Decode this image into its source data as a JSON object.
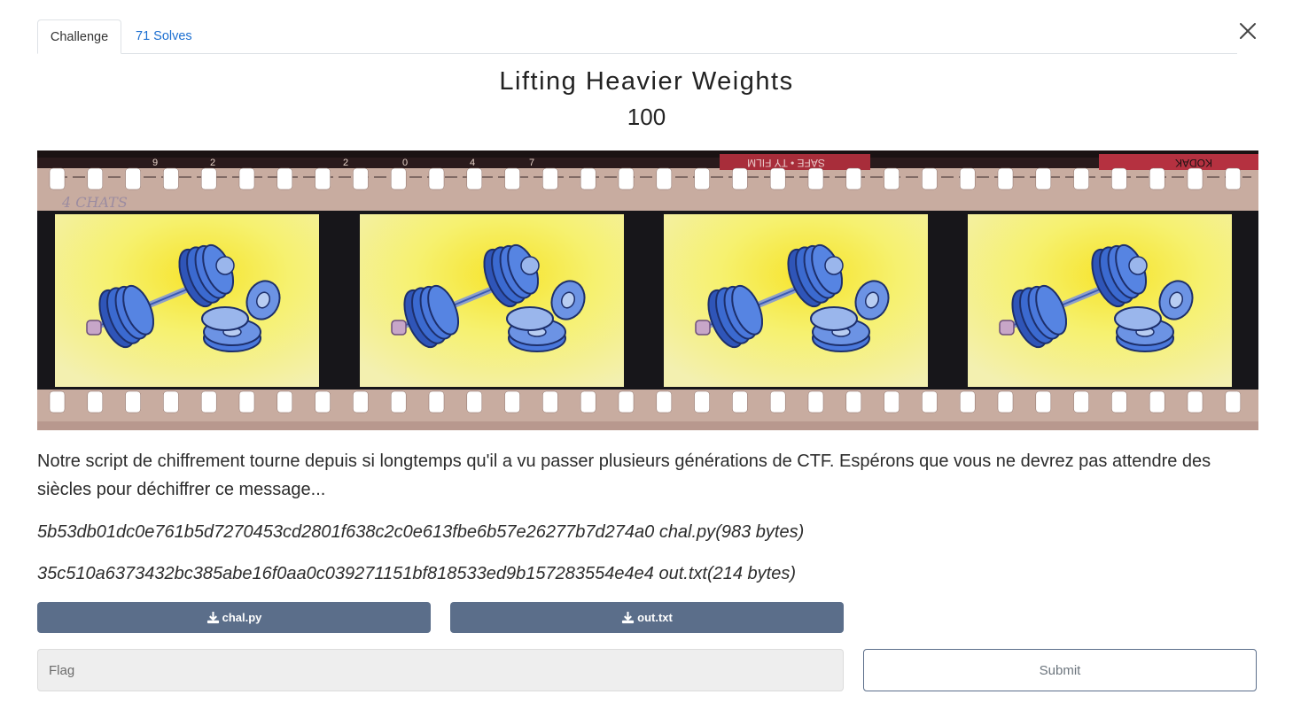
{
  "tabs": {
    "challenge": "Challenge",
    "solves": "71 Solves"
  },
  "challenge": {
    "name": "Lifting Heavier Weights",
    "value": "100",
    "description": "Notre script de chiffrement tourne depuis si longtemps qu'il a vu passer plusieurs générations de CTF. Espérons que vous ne devrez pas attendre des siècles pour déchiffrer ce message..."
  },
  "image": {
    "film_text_1": "SAFE • TY FILM",
    "film_text_2": "KODAK",
    "frame_numbers": [
      "9",
      "2",
      "2",
      "0",
      "4",
      "7"
    ],
    "annotation": "4 CHATS"
  },
  "files": [
    {
      "hash": "5b53db01dc0e761b5d7270453cd2801f638c2c0e613fbe6b57e26277b7d274a0",
      "name": "chal.py",
      "size": "(983 bytes)"
    },
    {
      "hash": "35c510a6373432bc385abe16f0aa0c039271151bf818533ed9b157283554e4e4",
      "name": "out.txt",
      "size": "(214 bytes)"
    }
  ],
  "downloads": {
    "file1_label": "chal.py",
    "file2_label": "out.txt"
  },
  "flag_form": {
    "placeholder": "Flag",
    "submit_label": "Submit"
  },
  "colors": {
    "accent_link": "#1c6fd1",
    "button_bg": "#5b6e8a",
    "film_base": "#c9ada1",
    "frame_yellow": "#f6f06a",
    "weight_blue": "#3f6fd0"
  },
  "icons": {
    "close": "close-icon",
    "download": "download-icon"
  }
}
